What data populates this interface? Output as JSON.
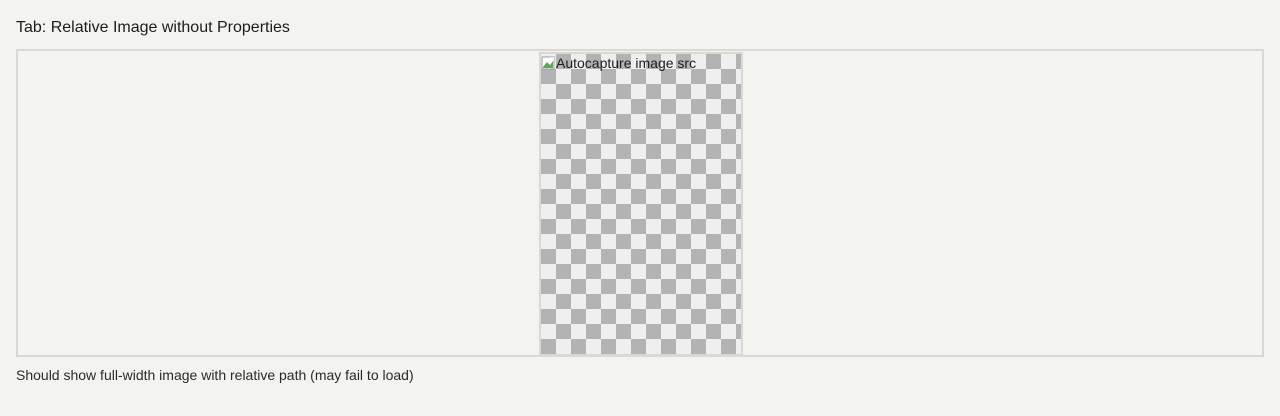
{
  "tab": {
    "title": "Tab: Relative Image without Properties"
  },
  "image": {
    "alt_text": "Autocapture image src",
    "status_icon": "broken-image-icon"
  },
  "caption": {
    "text": "Should show full-width image with relative path (may fail to load)"
  },
  "colors": {
    "background": "#f3f3ef",
    "frame_border": "#d9dad4",
    "checker_dark": "#b3b3b3",
    "checker_light": "#efefef"
  }
}
